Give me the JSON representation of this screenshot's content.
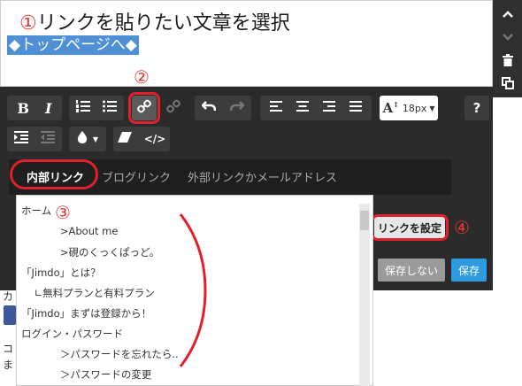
{
  "editor": {
    "annotation_number": "①",
    "annotation_text": "リンクを貼りたい文章を選択",
    "selected_text": "◆トップページへ◆"
  },
  "toolbar": {
    "bold": "B",
    "italic": "I",
    "font_size": "18px",
    "help": "?"
  },
  "tabs": [
    {
      "label": "内部リンク"
    },
    {
      "label": "ブログリンク"
    },
    {
      "label": "外部リンクかメールアドレス"
    }
  ],
  "list": {
    "items": [
      {
        "label": "ホーム"
      },
      {
        "label": "            >About me"
      },
      {
        "label": "            >硯のくっくぱっど。"
      },
      {
        "label": "「Jimdo」とは？"
      },
      {
        "label": "    ∟無料プランと有料プラン"
      },
      {
        "label": "「Jimdo」まずは登録から！"
      },
      {
        "label": "ログイン・パスワード"
      },
      {
        "label": "            ＞パスワードを忘れたら.."
      },
      {
        "label": "            ＞パスワードの変更"
      }
    ]
  },
  "buttons": {
    "set_link": "リンクを設定",
    "no_save": "保存しない",
    "save": "保存"
  },
  "annotations": {
    "n2": "②",
    "n3": "③",
    "n4": "④"
  },
  "page_behind": {
    "ka": "カ",
    "ko": "コ",
    "ma": "ま"
  },
  "colors": {
    "highlight": "#4f8fd6",
    "annotation_red": "#e0202a",
    "arrow_orange": "#f08a24",
    "save_blue": "#2e9be0"
  }
}
